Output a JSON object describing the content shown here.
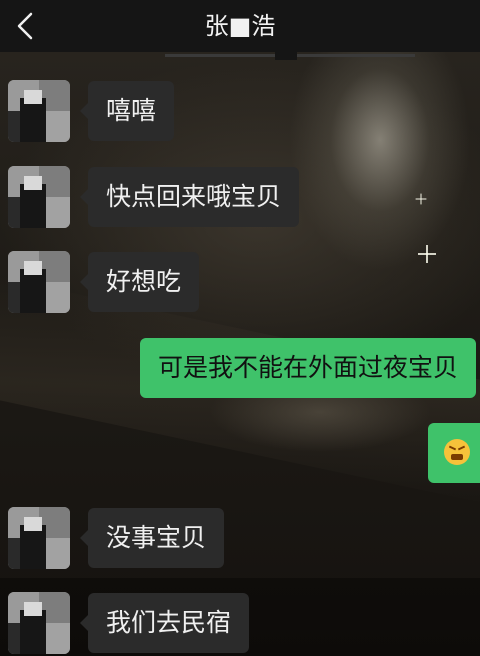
{
  "header": {
    "title": "张■浩",
    "back_icon": "chevron-left-icon"
  },
  "messages": [
    {
      "side": "left",
      "text": "嘻嘻"
    },
    {
      "side": "left",
      "text": "快点回来哦宝贝"
    },
    {
      "side": "left",
      "text": "好想吃"
    },
    {
      "side": "right",
      "text": "可是我不能在外面过夜宝贝"
    },
    {
      "side": "right",
      "text": "",
      "icon": "grimacing-face-emoji"
    },
    {
      "side": "left",
      "text": "没事宝贝"
    },
    {
      "side": "left",
      "text": "我们去民宿"
    }
  ],
  "colors": {
    "sent_bubble": "#3fc26a",
    "received_bubble": "#2b2b2b",
    "header_bg": "#151515"
  }
}
